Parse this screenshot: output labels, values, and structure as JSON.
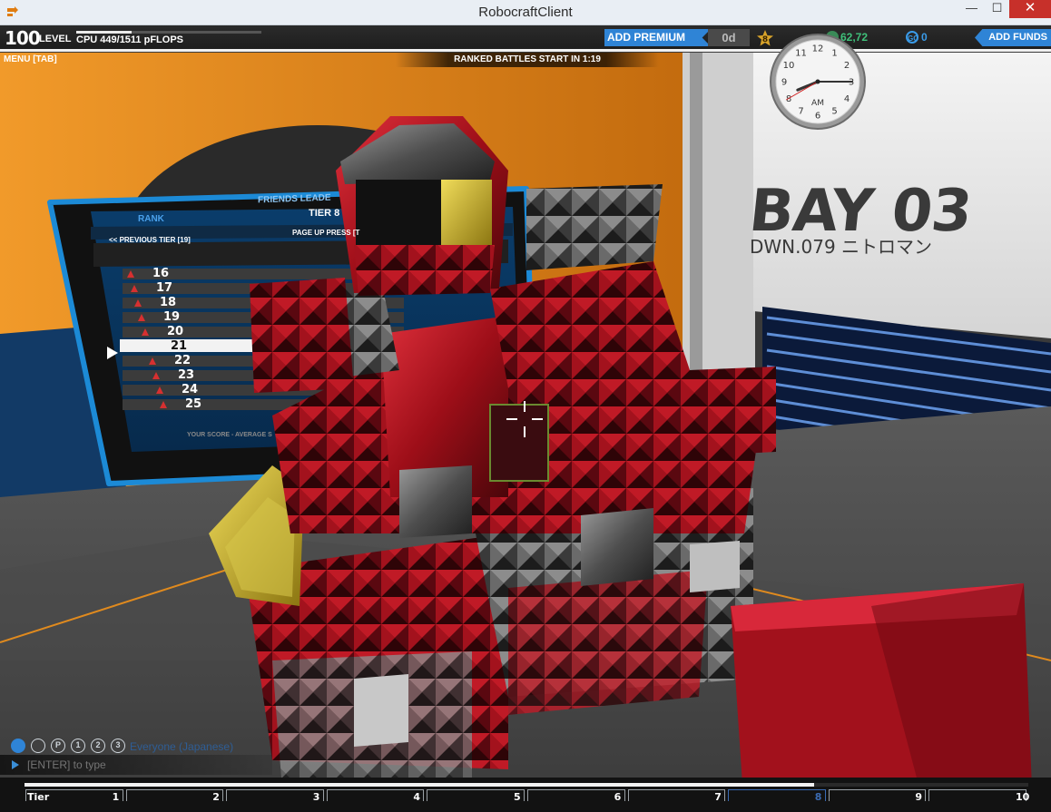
{
  "window": {
    "title": "RobocraftClient",
    "minimize_glyph": "—",
    "maximize_glyph": "☐",
    "close_glyph": "✕"
  },
  "hud": {
    "level": "100",
    "level_label": "LEVEL",
    "cpu_label": "CPU 449/1511 pFLOPS",
    "cpu_fraction": 0.297,
    "add_premium_label": "ADD PREMIUM",
    "premium_days": "0d",
    "tier_badge": "8",
    "robits_value": "62,72",
    "galaxy_coins_icon": "GC",
    "galaxy_coins": "0",
    "add_funds_label": "ADD FUNDS",
    "menu_label": "MENU [TAB]",
    "ranked_banner": "RANKED BATTLES START IN 1:19"
  },
  "clock": {
    "numbers": [
      "12",
      "1",
      "2",
      "3",
      "4",
      "5",
      "6",
      "7",
      "8",
      "9",
      "10",
      "11"
    ],
    "meridiem": "AM",
    "hour": 8,
    "minute": 15,
    "second": 40
  },
  "leaderboard": {
    "header": "FRIENDS LEADE",
    "rank_label": "RANK",
    "tier_label": "TIER 8",
    "prev_tier": "<< PREVIOUS TIER [19]",
    "page_up": "PAGE UP PRESS [T",
    "ranks": [
      "16",
      "17",
      "18",
      "19",
      "20",
      "21",
      "22",
      "23",
      "24",
      "25"
    ],
    "selected_rank": "21",
    "footer": "YOUR SCORE - AVERAGE S"
  },
  "bay": {
    "title": "BAY 03",
    "subtitle": "DWN.079 ニトロマン"
  },
  "chat": {
    "icons": [
      "globe-icon",
      "person-icon",
      "p-icon",
      "party-1-icon",
      "party-2-icon",
      "party-3-icon"
    ],
    "icon_texts": [
      "",
      "",
      "P",
      "1",
      "2",
      "3"
    ],
    "channel": "Everyone (Japanese)",
    "placeholder": "[ENTER] to type"
  },
  "tier_bar": {
    "label_first": "Tier",
    "tiers": [
      "1",
      "2",
      "3",
      "4",
      "5",
      "6",
      "7",
      "8",
      "9",
      "10"
    ],
    "current_tier": "8",
    "progress_fraction": 0.787
  },
  "colors": {
    "accent_blue": "#2f84d6",
    "robot_red": "#b0101c",
    "robot_grey": "#5b5b5b",
    "robot_yellow": "#c9b12a",
    "wall_orange": "#e08a1e",
    "rp_green": "#3fc07a"
  }
}
